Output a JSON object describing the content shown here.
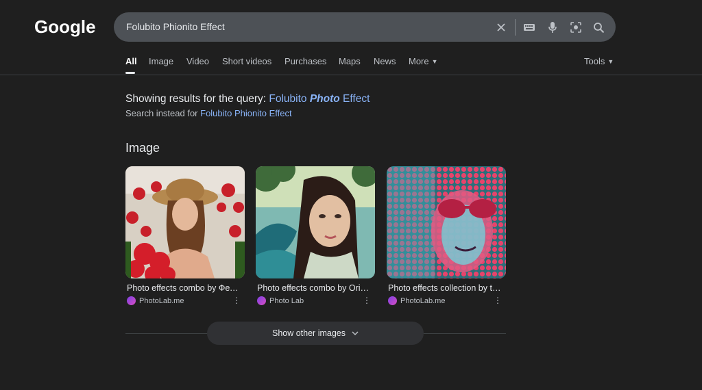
{
  "logo": "Google",
  "search": {
    "query": "Folubito Phionito Effect"
  },
  "tabs": [
    {
      "label": "All",
      "active": true
    },
    {
      "label": "Image"
    },
    {
      "label": "Video"
    },
    {
      "label": "Short videos"
    },
    {
      "label": "Purchases"
    },
    {
      "label": "Maps"
    },
    {
      "label": "News"
    },
    {
      "label": "More"
    }
  ],
  "tools_label": "Tools",
  "correction": {
    "prefix": "Showing results for the query: ",
    "q_part1": "Folubito ",
    "q_part2": "Photo",
    "q_part3": " Effect",
    "instead_prefix": "Search instead for ",
    "instead_link": "Folubito Phionito Effect"
  },
  "image_section": {
    "title": "Image",
    "items": [
      {
        "caption": "Photo effects combo by Фел...",
        "source": "PhotoLab.me"
      },
      {
        "caption": "Photo effects combo by Orifj...",
        "source": "Photo Lab"
      },
      {
        "caption": "Photo effects collection by ta...",
        "source": "PhotoLab.me"
      }
    ],
    "show_more": "Show other images"
  }
}
